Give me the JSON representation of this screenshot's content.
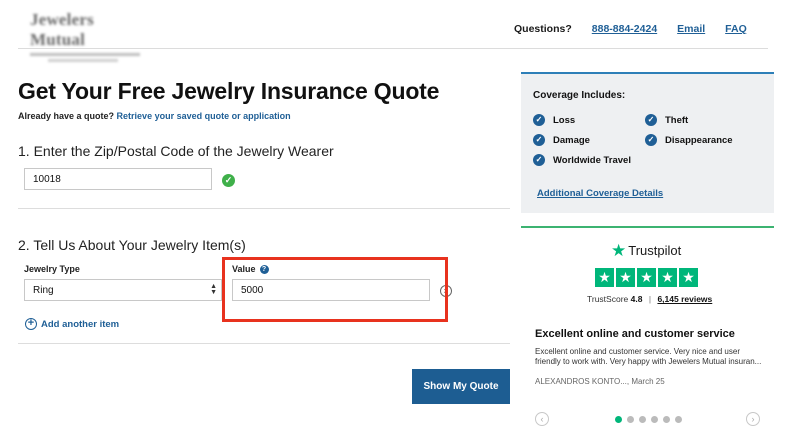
{
  "header": {
    "logo_text": "Jewelers Mutual",
    "questions_label": "Questions?",
    "phone": "888-884-2424",
    "email_label": "Email",
    "faq_label": "FAQ"
  },
  "main": {
    "title": "Get Your Free Jewelry Insurance Quote",
    "subtitle_prefix": "Already have a quote?",
    "subtitle_link": "Retrieve your saved quote or application",
    "step1_heading": "1. Enter the Zip/Postal Code of the Jewelry Wearer",
    "zip_value": "10018",
    "step2_heading": "2. Tell Us About Your Jewelry Item(s)",
    "jewelry_type_label": "Jewelry Type",
    "jewelry_type_selected": "Ring",
    "value_label": "Value",
    "value_input": "5000",
    "add_item_label": "Add another item",
    "show_quote_label": "Show My Quote"
  },
  "coverage": {
    "title": "Coverage Includes:",
    "items": [
      "Loss",
      "Damage",
      "Worldwide Travel",
      "Theft",
      "Disappearance"
    ],
    "details_link": "Additional Coverage Details"
  },
  "trustpilot": {
    "brand": "Trustpilot",
    "stars": 5,
    "score_label": "TrustScore",
    "score": "4.8",
    "reviews_label": "6,145 reviews",
    "review": {
      "title": "Excellent online and customer service",
      "text": "Excellent online and customer service. Very nice and user friendly to work with. Very happy with Jewelers Mutual insuran...",
      "author_date": "ALEXANDROS KONTO..., March 25"
    },
    "carousel": {
      "pages": 6,
      "active": 1
    }
  },
  "colors": {
    "brand_blue": "#1f5f96",
    "button_blue": "#1d5d92",
    "trustpilot_green": "#00b67a",
    "check_green": "#3fb04a",
    "highlight_red": "#e8321e"
  }
}
